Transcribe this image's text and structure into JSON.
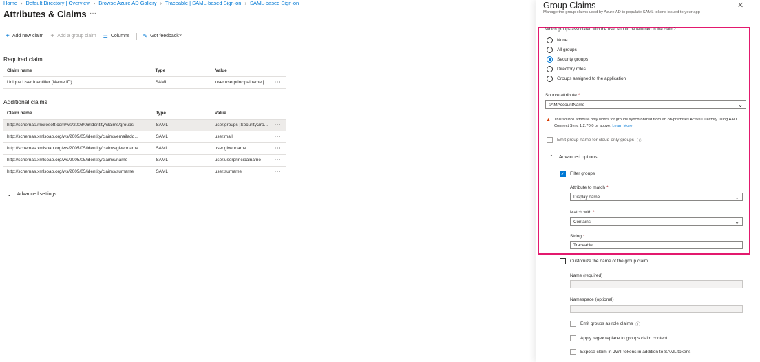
{
  "breadcrumb": [
    "Home",
    "Default Directory | Overview",
    "Browse Azure AD Gallery",
    "Traceable | SAML-based Sign-on",
    "SAML-based Sign-on"
  ],
  "page_title": "Attributes & Claims",
  "title_more": "···",
  "toolbar": {
    "add_new_claim": "Add new claim",
    "add_group_claim": "Add a group claim",
    "columns": "Columns",
    "got_feedback": "Got feedback?"
  },
  "required": {
    "title": "Required claim",
    "headers": [
      "Claim name",
      "Type",
      "Value"
    ],
    "rows": [
      {
        "name": "Unique User Identifier (Name ID)",
        "type": "SAML",
        "value": "user.userprincipalname [..."
      }
    ]
  },
  "additional": {
    "title": "Additional claims",
    "headers": [
      "Claim name",
      "Type",
      "Value"
    ],
    "rows": [
      {
        "name": "http://schemas.microsoft.com/ws/2008/06/identity/claims/groups",
        "type": "SAML",
        "value": "user.groups [SecurityGro..."
      },
      {
        "name": "http://schemas.xmlsoap.org/ws/2005/05/identity/claims/emailadd...",
        "type": "SAML",
        "value": "user.mail"
      },
      {
        "name": "http://schemas.xmlsoap.org/ws/2005/05/identity/claims/givenname",
        "type": "SAML",
        "value": "user.givenname"
      },
      {
        "name": "http://schemas.xmlsoap.org/ws/2005/05/identity/claims/name",
        "type": "SAML",
        "value": "user.userprincipalname"
      },
      {
        "name": "http://schemas.xmlsoap.org/ws/2005/05/identity/claims/surname",
        "type": "SAML",
        "value": "user.surname"
      }
    ]
  },
  "row_menu": "···",
  "advanced_settings": "Advanced settings",
  "panel": {
    "title": "Group Claims",
    "subtitle": "Manage the group claims used by Azure AD to populate SAML tokens issued to your app",
    "question": "Which groups associated with the user should be returned in the claim?",
    "radio_options": [
      "None",
      "All groups",
      "Security groups",
      "Directory roles",
      "Groups assigned to the application"
    ],
    "selected_option": "Security groups",
    "source_attribute_label": "Source attribute",
    "source_attribute_value": "sAMAccountName",
    "warning_text": "This source attribute only works for groups synchronized from an on-premises Active Directory using AAD Connect Sync 1.2.70.0 or above.",
    "learn_more": "Learn More",
    "emit_cloud_only": "Emit group name for cloud-only groups",
    "advanced_options": "Advanced options",
    "filter_groups": "Filter groups",
    "attribute_to_match_label": "Attribute to match",
    "attribute_to_match_value": "Display name",
    "match_with_label": "Match with",
    "match_with_value": "Contains",
    "string_label": "String",
    "string_value": "Traceable",
    "customize_name": "Customize the name of the group claim",
    "name_label": "Name (required)",
    "namespace_label": "Namespace (optional)",
    "emit_role_claims": "Emit groups as role claims",
    "apply_regex": "Apply regex replace to groups claim content",
    "expose_jwt": "Expose claim in JWT tokens in addition to SAML tokens"
  },
  "colors": {
    "accent": "#0078d4",
    "highlight": "#e3196e",
    "warning": "#d83b01"
  }
}
